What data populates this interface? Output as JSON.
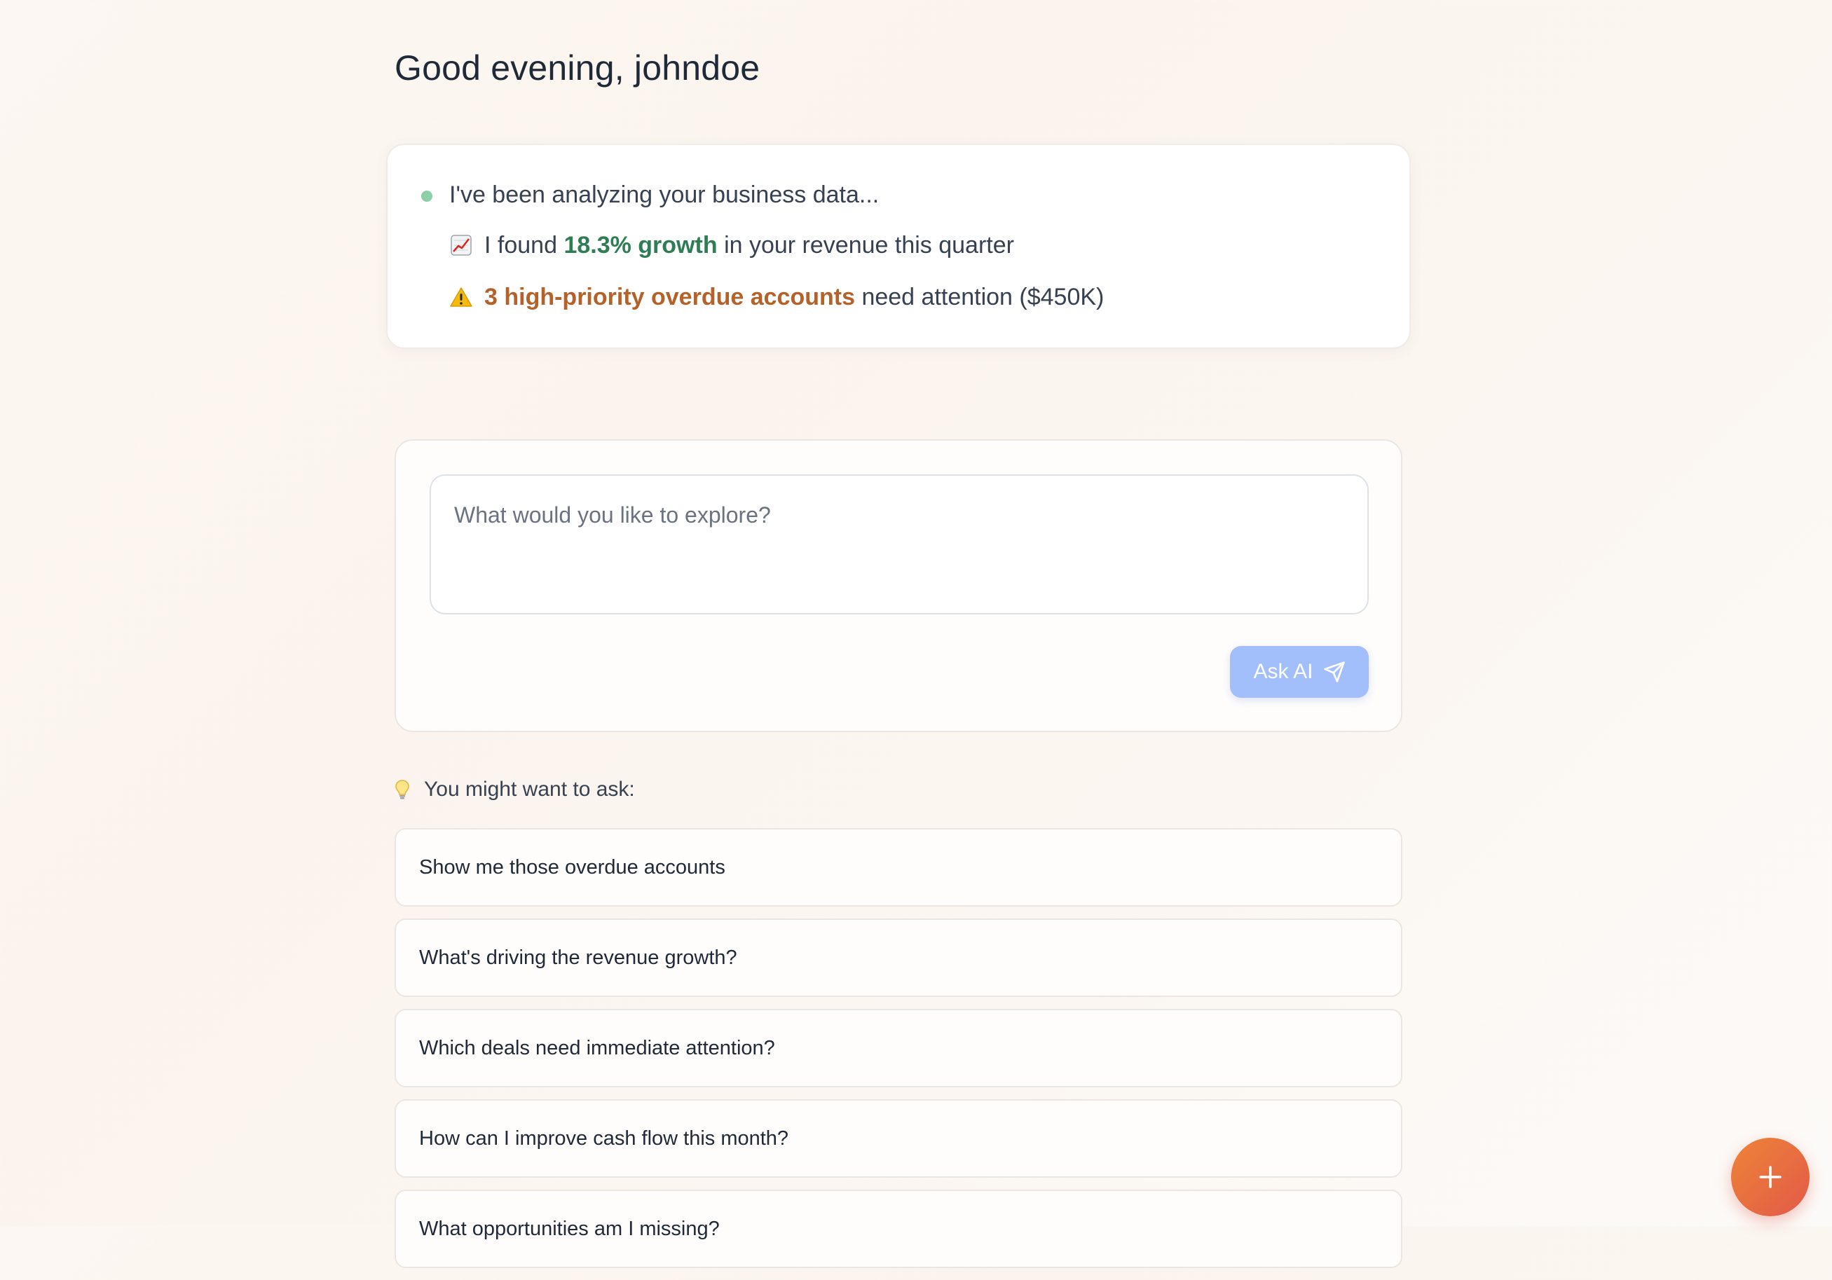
{
  "greeting": "Good evening, johndoe",
  "insights": {
    "status": "I've been analyzing your business data...",
    "growth": {
      "icon": "chart-increasing-icon",
      "prefix": "I found",
      "highlight": "18.3% growth",
      "suffix": "in your revenue this quarter",
      "highlight_color": "#2f7d55"
    },
    "overdue": {
      "icon": "warning-icon",
      "highlight": "3 high-priority overdue accounts",
      "suffix": "need attention ($450K)",
      "highlight_color": "#b4622a"
    }
  },
  "ask": {
    "placeholder": "What would you like to explore?",
    "value": "",
    "button_label": "Ask AI",
    "button_icon": "send-icon",
    "button_color": "#a3bffb"
  },
  "suggestions": {
    "icon": "lightbulb-icon",
    "label": "You might want to ask:",
    "items": [
      "Show me those overdue accounts",
      "What's driving the revenue growth?",
      "Which deals need immediate attention?",
      "How can I improve cash flow this month?",
      "What opportunities am I missing?"
    ]
  },
  "fab": {
    "icon": "plus-icon",
    "colors": [
      "#ee8338",
      "#e25a48"
    ]
  }
}
